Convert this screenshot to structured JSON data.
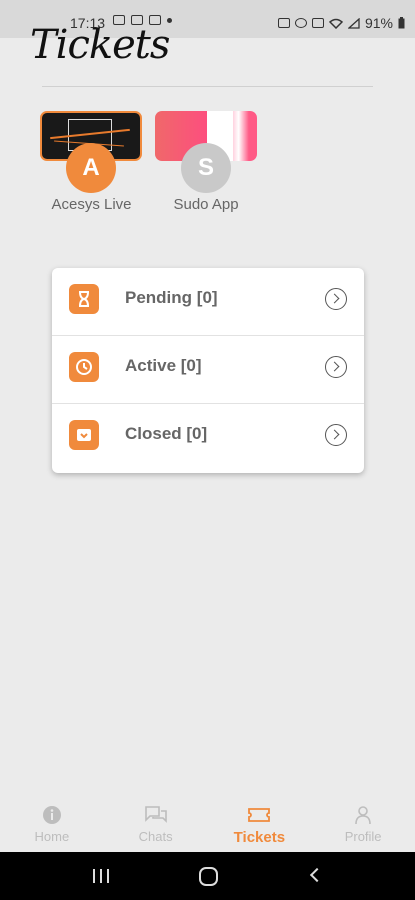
{
  "status_bar": {
    "time": "17:13",
    "battery": "91%",
    "icons": [
      "image-icon",
      "mail-icon",
      "youtube-icon",
      "dot-icon",
      "key-icon",
      "alarm-icon",
      "mute-icon",
      "wifi-icon",
      "signal-icon",
      "battery-icon"
    ]
  },
  "page": {
    "title": "Tickets"
  },
  "apps": [
    {
      "initial": "A",
      "name": "Acesys Live"
    },
    {
      "initial": "S",
      "name": "Sudo App"
    }
  ],
  "tickets": [
    {
      "label": "Pending [0]",
      "icon": "hourglass-icon"
    },
    {
      "label": "Active [0]",
      "icon": "timer-icon"
    },
    {
      "label": "Closed [0]",
      "icon": "inbox-icon"
    }
  ],
  "bottom_nav": {
    "items": [
      {
        "label": "Home",
        "icon": "info-icon"
      },
      {
        "label": "Chats",
        "icon": "chat-icon"
      },
      {
        "label": "Tickets",
        "icon": "ticket-icon"
      },
      {
        "label": "Profile",
        "icon": "person-icon"
      }
    ],
    "active_index": 2
  },
  "colors": {
    "accent": "#f08a3c",
    "background": "#ebebeb"
  }
}
